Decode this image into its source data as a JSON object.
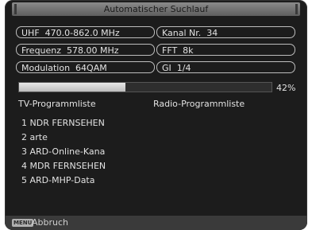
{
  "title": "Automatischer Suchlauf",
  "info": {
    "uhf": "UHF  470.0-862.0 MHz",
    "frequenz": "Frequenz  578.00 MHz",
    "modulation": "Modulation  64QAM",
    "kanal": "Kanal Nr.  34",
    "fft": "FFT  8k",
    "gi": "GI  1/4"
  },
  "progress": {
    "percent": 42,
    "label": "42%"
  },
  "tv_header": "TV-Programmliste",
  "radio_header": "Radio-Programmliste",
  "tv_channels": [
    "1 NDR FERNSEHEN",
    "2 arte",
    "3 ARD-Online-Kana",
    "4 MDR FERNSEHEN",
    "5 ARD-MHP-Data"
  ],
  "radio_channels": [],
  "footer": {
    "menu_key": "MENU",
    "action": "Abbruch"
  },
  "colors": {
    "background": "#1c1c1c",
    "text": "#e2e2e2",
    "progress_fill": "#d6d6d6"
  }
}
